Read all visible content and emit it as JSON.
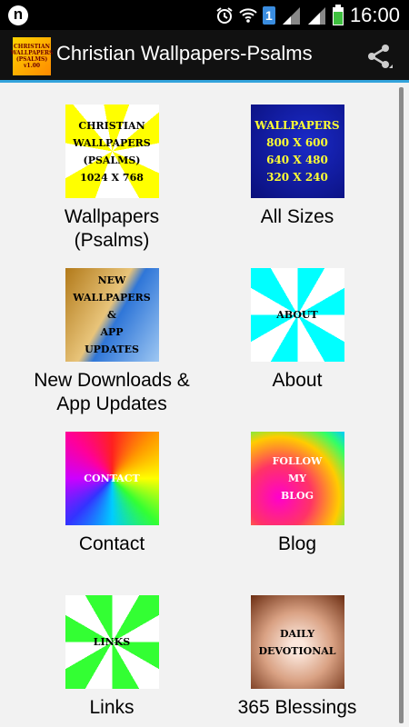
{
  "status_bar": {
    "time": "16:00",
    "notification_badge": "1",
    "icons": [
      "n-app-icon",
      "alarm-icon",
      "wifi-icon",
      "sim-badge-icon",
      "signal-icon",
      "signal-icon-2",
      "battery-icon"
    ]
  },
  "action_bar": {
    "title": "Christian Wallpapers-Psalms",
    "app_icon_text": [
      "CHRISTIAN",
      "WALLPAPERS",
      "(PSALMS)",
      "v1.00"
    ],
    "share_icon": "share-icon"
  },
  "colors": {
    "accent": "#33a3dc",
    "actionbar": "#111111",
    "background": "#f2f2f2"
  },
  "tiles": [
    {
      "label_lines": [
        "Wallpapers",
        "(Psalms)"
      ],
      "thumb_lines": [
        "CHRISTIAN",
        "WALLPAPERS",
        "(PSALMS)",
        "1024 X 768"
      ]
    },
    {
      "label_lines": [
        "All Sizes"
      ],
      "thumb_lines": [
        "WALLPAPERS",
        "800 X 600",
        "640 X 480",
        "320 X 240"
      ]
    },
    {
      "label_lines": [
        "New Downloads &",
        "App Updates"
      ],
      "thumb_lines": [
        "NEW",
        "WALLPAPERS",
        "&",
        "APP",
        "UPDATES"
      ]
    },
    {
      "label_lines": [
        "About"
      ],
      "thumb_lines": [
        "ABOUT"
      ]
    },
    {
      "label_lines": [
        "Contact"
      ],
      "thumb_lines": [
        "CONTACT"
      ]
    },
    {
      "label_lines": [
        "Blog"
      ],
      "thumb_lines": [
        "FOLLOW",
        "MY",
        "BLOG"
      ]
    },
    {
      "label_lines": [
        "Links"
      ],
      "thumb_lines": [
        "LINKS"
      ]
    },
    {
      "label_lines": [
        "365 Blessings"
      ],
      "thumb_lines": [
        "DAILY",
        "DEVOTIONAL"
      ]
    }
  ]
}
